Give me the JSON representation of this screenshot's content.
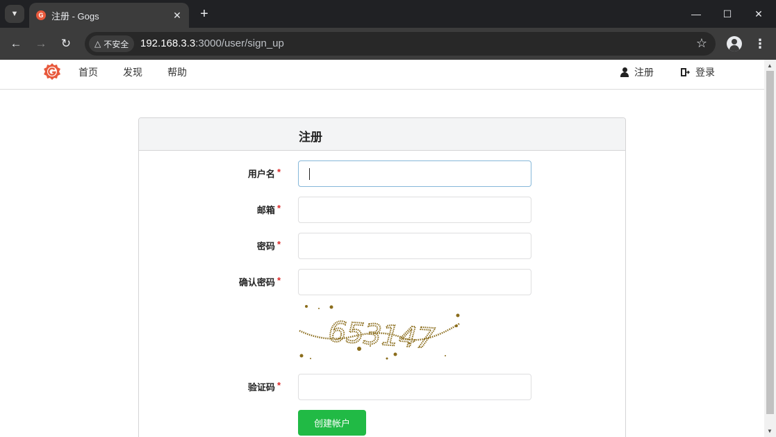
{
  "browser": {
    "tab_title": "注册 - Gogs",
    "favicon_letter": "G",
    "security_label": "不安全",
    "url_host": "192.168.3.3",
    "url_rest": ":3000/user/sign_up"
  },
  "header": {
    "nav": [
      "首页",
      "发现",
      "帮助"
    ],
    "signup_label": "注册",
    "signin_label": "登录"
  },
  "form": {
    "title": "注册",
    "fields": [
      {
        "label": "用户名",
        "value": ""
      },
      {
        "label": "邮箱",
        "value": ""
      },
      {
        "label": "密码",
        "value": ""
      },
      {
        "label": "确认密码",
        "value": ""
      }
    ],
    "captcha_text": "653147",
    "captcha_field_label": "验证码",
    "required_mark": "*",
    "submit_label": "创建帐户"
  },
  "colors": {
    "brand": "#e8593c",
    "submit": "#21ba45",
    "required": "#db2828",
    "captcha": "#8b6d1c"
  }
}
